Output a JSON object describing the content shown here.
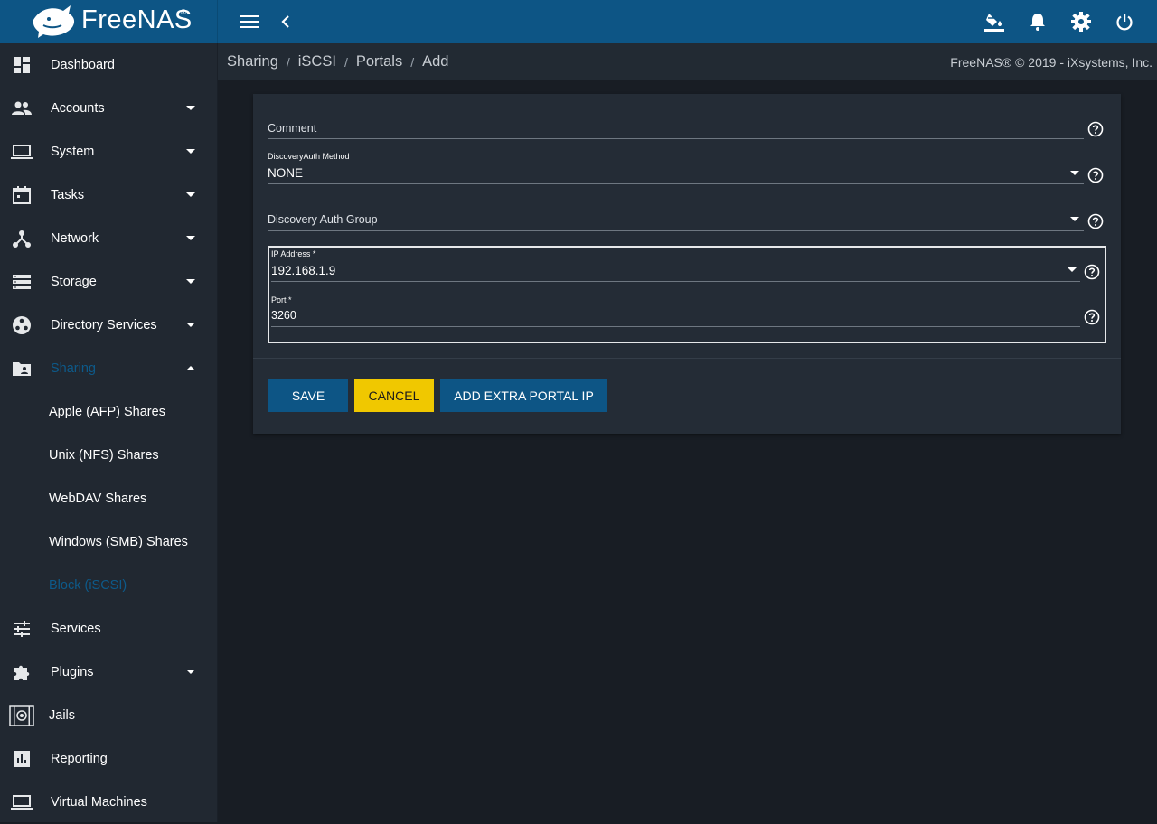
{
  "app": {
    "name": "FreeNAS",
    "reg_mark": "®"
  },
  "topbar": {
    "icons": [
      "menu-icon",
      "back-chevron-icon",
      "theme-paint-icon",
      "notifications-bell-icon",
      "settings-gear-icon",
      "power-icon"
    ]
  },
  "sidebar": {
    "items": [
      {
        "label": "Dashboard",
        "icon": "dashboard-icon"
      },
      {
        "label": "Accounts",
        "icon": "accounts-icon"
      },
      {
        "label": "System",
        "icon": "system-laptop-icon"
      },
      {
        "label": "Tasks",
        "icon": "calendar-icon"
      },
      {
        "label": "Network",
        "icon": "network-icon"
      },
      {
        "label": "Storage",
        "icon": "storage-icon"
      },
      {
        "label": "Directory Services",
        "icon": "directory-icon"
      },
      {
        "label": "Sharing",
        "icon": "folder-shared-icon"
      },
      {
        "label": "Services",
        "icon": "tune-icon"
      },
      {
        "label": "Plugins",
        "icon": "extension-puzzle-icon"
      },
      {
        "label": "Jails",
        "icon": "jail-icon"
      },
      {
        "label": "Reporting",
        "icon": "bar-chart-icon"
      },
      {
        "label": "Virtual Machines",
        "icon": "laptop-icon"
      }
    ],
    "sharing_sub": [
      {
        "label": "Apple (AFP) Shares"
      },
      {
        "label": "Unix (NFS) Shares"
      },
      {
        "label": "WebDAV Shares"
      },
      {
        "label": "Windows (SMB) Shares"
      },
      {
        "label": "Block (iSCSI)"
      }
    ]
  },
  "breadcrumb": {
    "items": [
      "Sharing",
      "iSCSI",
      "Portals",
      "Add"
    ],
    "separator": "/"
  },
  "copyright": "FreeNAS® © 2019 - iXsystems, Inc.",
  "form": {
    "comment": {
      "placeholder": "Comment"
    },
    "discovery_auth_method": {
      "label": "DiscoveryAuth Method",
      "value": "NONE"
    },
    "discovery_auth_group": {
      "placeholder": "Discovery Auth Group"
    },
    "ip_address": {
      "label": "IP Address *",
      "value": "192.168.1.9"
    },
    "port": {
      "label": "Port *",
      "value": "3260"
    }
  },
  "buttons": {
    "save": "SAVE",
    "cancel": "CANCEL",
    "add_extra": "ADD EXTRA PORTAL IP"
  },
  "colors": {
    "topbar": "#0d5585",
    "sidebar": "#212831",
    "content_bg": "#181d24",
    "card": "#242c36",
    "active_nav": "#0d5a8a",
    "cancel_button": "#f0c800"
  }
}
